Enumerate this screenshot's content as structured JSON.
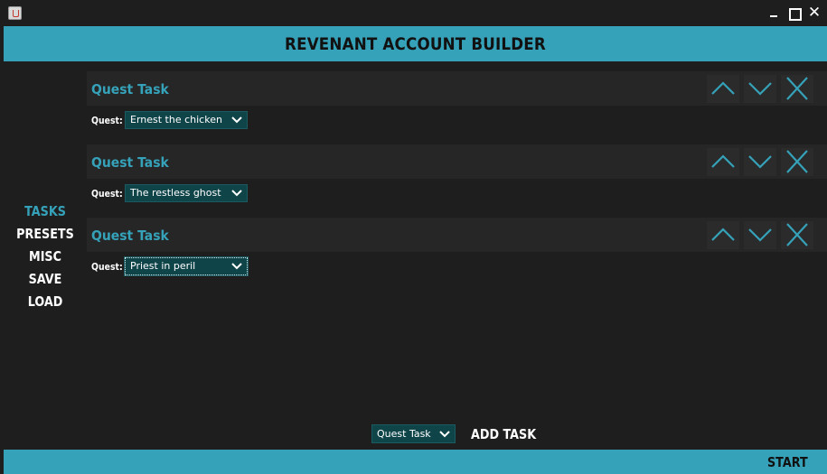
{
  "window": {
    "close_glyph": "✕"
  },
  "header": {
    "title": "REVENANT ACCOUNT BUILDER"
  },
  "nav": {
    "items": [
      {
        "label": "TASKS",
        "active": true
      },
      {
        "label": "PRESETS",
        "active": false
      },
      {
        "label": "MISC",
        "active": false
      },
      {
        "label": "SAVE",
        "active": false
      },
      {
        "label": "LOAD",
        "active": false
      }
    ]
  },
  "tasks": [
    {
      "title": "Quest Task",
      "quest_label": "Quest:",
      "quest_value": "Ernest the chicken"
    },
    {
      "title": "Quest Task",
      "quest_label": "Quest:",
      "quest_value": "The restless ghost"
    },
    {
      "title": "Quest Task",
      "quest_label": "Quest:",
      "quest_value": "Priest in peril"
    }
  ],
  "task_icons": {
    "up": "chevron-up-icon",
    "down": "chevron-down-icon",
    "remove": "close-icon"
  },
  "footer": {
    "task_type_value": "Quest Task",
    "add_task_label": "ADD TASK",
    "start_label": "START"
  },
  "colors": {
    "accent": "#35a2b9",
    "background": "#1e1e1e",
    "panel": "#262626",
    "select_bg": "#0f4449"
  }
}
